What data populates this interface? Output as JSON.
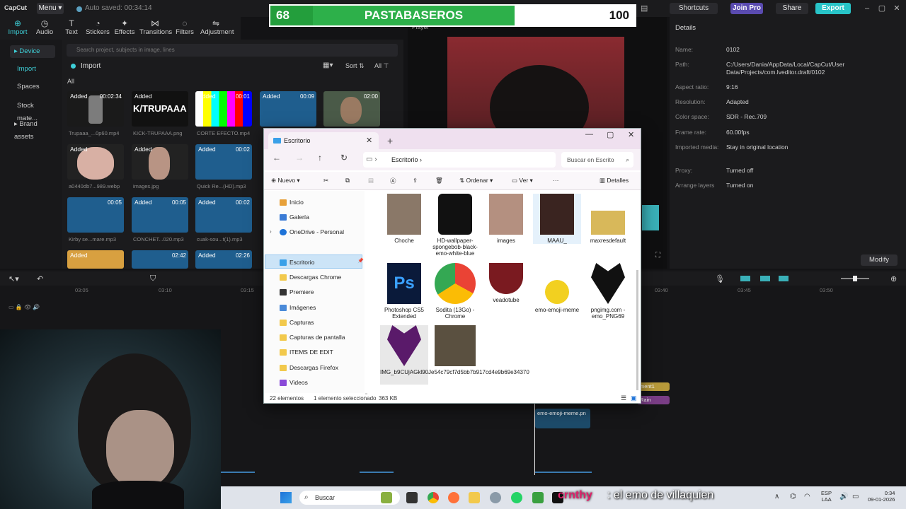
{
  "capcut": {
    "logo": "CapCut",
    "menu": "Menu",
    "autosave": "Auto saved: 00:34:14",
    "shortcuts": "Shortcuts",
    "join_pro": "Join Pro",
    "share": "Share",
    "export": "Export",
    "tools": [
      "Import",
      "Audio",
      "Text",
      "Stickers",
      "Effects",
      "Transitions",
      "Filters",
      "Adjustment"
    ],
    "sidebar": [
      "Device",
      "Import",
      "Spaces",
      "Stock mate...",
      "Brand assets"
    ],
    "search_placeholder": "Search project, subjects in image, lines",
    "import_label": "Import",
    "sort": "Sort",
    "all_filter": "All",
    "all_label": "All",
    "media": [
      {
        "caption": "Trupaaa_...0p60.mp4",
        "added": "Added",
        "duration": "00:02:34"
      },
      {
        "caption": "KICK-TRUPAAA.png",
        "added": "Added",
        "duration": ""
      },
      {
        "caption": "CORTE EFECTO.mp4",
        "added": "Added",
        "duration": "00:01"
      },
      {
        "caption": "",
        "added": "Added",
        "duration": "00:09"
      },
      {
        "caption": "",
        "added": "",
        "duration": "02:00"
      },
      {
        "caption": "a0440db7...989.webp",
        "added": "Added",
        "duration": ""
      },
      {
        "caption": "images.jpg",
        "added": "Added",
        "duration": ""
      },
      {
        "caption": "Quick Re...(HD).mp3",
        "added": "Added",
        "duration": "00:02"
      },
      {
        "caption": "Kirby se...mare.mp3",
        "added": "",
        "duration": "00:05"
      },
      {
        "caption": "CONCHET...020.mp3",
        "added": "Added",
        "duration": "00:05"
      },
      {
        "caption": "cuak-sou...t(1).mp3",
        "added": "Added",
        "duration": "00:02"
      },
      {
        "caption": "",
        "added": "Added",
        "duration": ""
      },
      {
        "caption": "",
        "added": "",
        "duration": "02:42"
      },
      {
        "caption": "",
        "added": "Added",
        "duration": "02:26"
      }
    ],
    "kick_text": "K/TRUPAAA",
    "player_title": "Player",
    "details": {
      "title": "Details",
      "rows": [
        {
          "label": "Name:",
          "value": "0102"
        },
        {
          "label": "Path:",
          "value": "C:/Users/Dania/AppData/Local/CapCut/User Data/Projects/com.lveditor.draft/0102"
        },
        {
          "label": "Aspect ratio:",
          "value": "9:16"
        },
        {
          "label": "Resolution:",
          "value": "Adapted"
        },
        {
          "label": "Color space:",
          "value": "SDR - Rec.709"
        },
        {
          "label": "Frame rate:",
          "value": "60.00fps"
        },
        {
          "label": "Imported media:",
          "value": "Stay in original location"
        },
        {
          "label": "Proxy:",
          "value": "Turned off"
        },
        {
          "label": "Arrange layers",
          "value": "Turned on"
        }
      ],
      "modify": "Modify"
    },
    "ruler": [
      "03:05",
      "03:10",
      "03:15",
      "03:40",
      "03:45",
      "03:50"
    ],
    "track_emo": "emo-emoji-meme.pn",
    "track_text1": "ment1",
    "track_text2": "Rain"
  },
  "scoreboard": {
    "left": "68",
    "title": "PASTABASEROS",
    "right": "100"
  },
  "explorer": {
    "tab": "Escritorio",
    "path": "Escritorio",
    "search": "Buscar en Escrito",
    "commands": {
      "new": "Nuevo",
      "order": "Ordenar",
      "view": "Ver",
      "details": "Detalles"
    },
    "nav": [
      {
        "label": "Inicio",
        "color": "#e7a13a"
      },
      {
        "label": "Galería",
        "color": "#3a7bd5"
      },
      {
        "label": "OneDrive - Personal",
        "color": "#1e73d8"
      },
      {
        "label": "Escritorio",
        "color": "#3aa0e8"
      },
      {
        "label": "Descargas Chrome",
        "color": "#f2c94c"
      },
      {
        "label": "Premiere",
        "color": "#333333"
      },
      {
        "label": "Imágenes",
        "color": "#4a8ad8"
      },
      {
        "label": "Capturas",
        "color": "#f2c94c"
      },
      {
        "label": "Capturas de pantalla",
        "color": "#f2c94c"
      },
      {
        "label": "ITEMS DE EDIT",
        "color": "#f2c94c"
      },
      {
        "label": "Descargas Firefox",
        "color": "#f2c94c"
      },
      {
        "label": "Videos",
        "color": "#8a4ad8"
      }
    ],
    "files": [
      {
        "name": "Choche"
      },
      {
        "name": "HD-wallpaper-spongebob-black-emo-white-blue"
      },
      {
        "name": "images"
      },
      {
        "name": "MAAU_"
      },
      {
        "name": "maxresdefault"
      },
      {
        "name": "Photoshop CS5 Extended"
      },
      {
        "name": "Sodita (13Go) - Chrome"
      },
      {
        "name": "veadotube"
      },
      {
        "name": "emo-emoji-meme"
      },
      {
        "name": "pngimg.com - emo_PNG69"
      },
      {
        "name": "IMG_b9CUjAGkl90J"
      },
      {
        "name": "e54c79cf7d5bb7b917cd4e9b69e34370"
      }
    ],
    "status": {
      "count": "22 elementos",
      "selected": "1 elemento seleccionado",
      "size": "363 KB"
    }
  },
  "taskbar": {
    "search": "Buscar",
    "lang": "ESP",
    "lang2": "LAA",
    "time": "0:34",
    "date": "09-01-2026",
    "overlay_name": "crnthy",
    "overlay_text": ": el emo de villaquien"
  }
}
